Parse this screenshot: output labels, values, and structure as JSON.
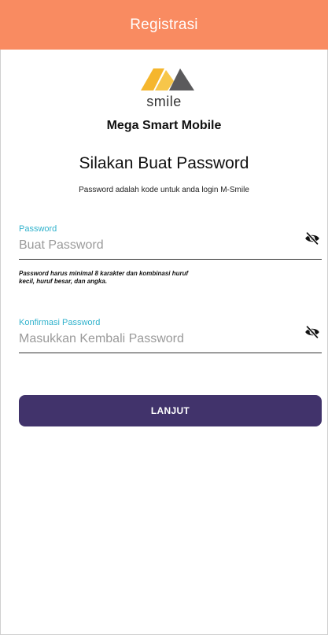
{
  "header": {
    "title": "Registrasi",
    "color": "#f98b61"
  },
  "logo": {
    "text": "smile",
    "icon": "msmile-logo-icon",
    "colors": [
      "#f5b62d",
      "#5b5a5c"
    ]
  },
  "app_name": "Mega Smart Mobile",
  "page": {
    "title": "Silakan Buat Password",
    "subtitle": "Password adalah kode untuk anda login M-Smile"
  },
  "password_field": {
    "label": "Password",
    "placeholder": "Buat Password",
    "value": "",
    "icon": "eye-off-icon"
  },
  "password_hint": "Password harus minimal 8 karakter dan kombinasi huruf kecil, huruf besar, dan angka.",
  "confirm_field": {
    "label": "Konfirmasi Password",
    "placeholder": "Masukkan Kembali Password",
    "value": "",
    "icon": "eye-off-icon"
  },
  "submit": {
    "label": "LANJUT",
    "color": "#41336b"
  },
  "accent_color": "#30b2cc"
}
